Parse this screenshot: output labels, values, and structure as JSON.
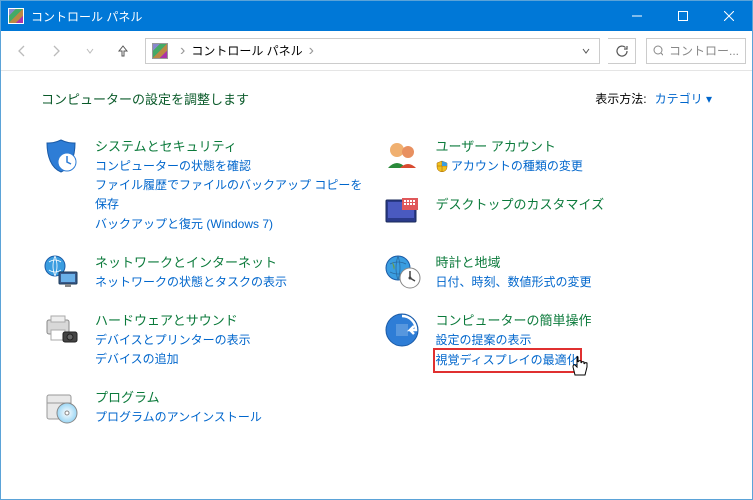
{
  "window": {
    "title": "コントロール パネル"
  },
  "addressbar": {
    "path": "コントロール パネル"
  },
  "search": {
    "placeholder": "コントロー..."
  },
  "heading": "コンピューターの設定を調整します",
  "viewby": {
    "label": "表示方法:",
    "value": "カテゴリ"
  },
  "left": [
    {
      "title": "システムとセキュリティ",
      "links": [
        "コンピューターの状態を確認",
        "ファイル履歴でファイルのバックアップ コピーを保存",
        "バックアップと復元 (Windows 7)"
      ]
    },
    {
      "title": "ネットワークとインターネット",
      "links": [
        "ネットワークの状態とタスクの表示"
      ]
    },
    {
      "title": "ハードウェアとサウンド",
      "links": [
        "デバイスとプリンターの表示",
        "デバイスの追加"
      ]
    },
    {
      "title": "プログラム",
      "links": [
        "プログラムのアンインストール"
      ]
    }
  ],
  "right": [
    {
      "title": "ユーザー アカウント",
      "links": [
        "アカウントの種類の変更"
      ],
      "shield_on": [
        0
      ]
    },
    {
      "title": "デスクトップのカスタマイズ",
      "links": []
    },
    {
      "title": "時計と地域",
      "links": [
        "日付、時刻、数値形式の変更"
      ]
    },
    {
      "title": "コンピューターの簡単操作",
      "links": [
        "設定の提案の表示",
        "視覚ディスプレイの最適化"
      ],
      "highlight": 1
    }
  ]
}
